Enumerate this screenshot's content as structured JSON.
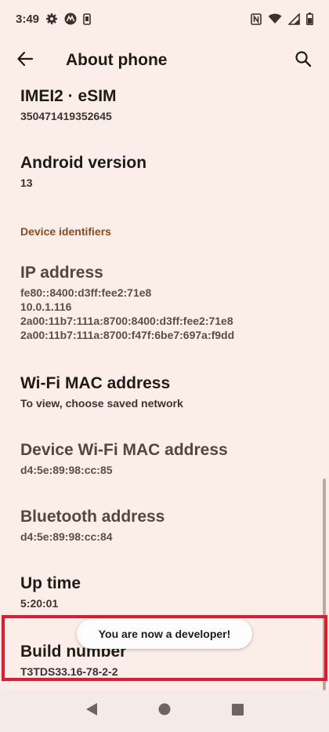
{
  "status_bar": {
    "time": "3:49",
    "icons_left": [
      "gear-icon",
      "motorola-logo-icon",
      "phone-outline-icon"
    ],
    "icons_right": [
      "nfc-icon",
      "wifi-icon",
      "signal-icon",
      "battery-icon"
    ]
  },
  "app_bar": {
    "title": "About phone",
    "back_icon": "arrow-back-icon",
    "search_icon": "search-icon"
  },
  "preferences": [
    {
      "title": "IMEI2 · eSIM",
      "summary": "350471419352645"
    },
    {
      "title": "Android version",
      "summary": "13"
    }
  ],
  "category": {
    "title": "Device identifiers"
  },
  "identifiers": [
    {
      "title": "IP address",
      "summary_lines": [
        "fe80::8400:d3ff:fee2:71e8",
        "10.0.1.116",
        "2a00:11b7:111a:8700:8400:d3ff:fee2:71e8",
        "2a00:11b7:111a:8700:f47f:6be7:697a:f9dd"
      ]
    },
    {
      "title": "Wi-Fi MAC address",
      "summary": "To view, choose saved network"
    },
    {
      "title": "Device Wi-Fi MAC address",
      "summary": "d4:5e:89:98:cc:85"
    },
    {
      "title": "Bluetooth address",
      "summary": "d4:5e:89:98:cc:84"
    },
    {
      "title": "Up time",
      "summary": "5:20:01"
    },
    {
      "title": "Build number",
      "summary": "T3TDS33.16-78-2-2"
    }
  ],
  "toast": {
    "message": "You are now a developer!"
  },
  "nav_bar": {
    "back_icon": "nav-back-icon",
    "home_icon": "nav-home-icon",
    "recents_icon": "nav-recents-icon"
  },
  "colors": {
    "background": "#fbeee8",
    "accent": "#8c4b1c",
    "highlight": "#e01b2b"
  }
}
